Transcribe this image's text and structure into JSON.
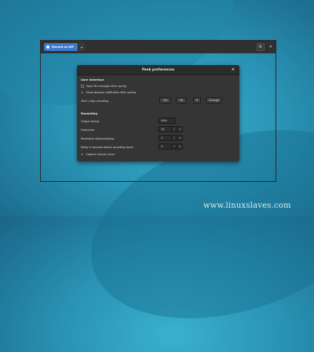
{
  "peek": {
    "record_label": "Record as GIF",
    "menu_icon": "chevron-down-icon",
    "settings_icon": "gear-icon",
    "close_icon": "close-icon"
  },
  "dialog": {
    "title": "Peek preferences",
    "close_glyph": "×",
    "user_interface": {
      "heading": "User interface",
      "open_file_manager": {
        "label": "Open file manager after saving",
        "checked": false
      },
      "show_notification": {
        "label": "Show desktop notification after saving",
        "checked": true
      },
      "shortcut": {
        "label": "Start / stop recording",
        "keys": [
          "Ctrl",
          "Alt",
          "R"
        ],
        "change_label": "Change"
      }
    },
    "recording": {
      "heading": "Recording",
      "output_format": {
        "label": "Output format",
        "value": "GIF"
      },
      "framerate": {
        "label": "Framerate",
        "value": "10"
      },
      "downsampling": {
        "label": "Resolution downsampling",
        "value": "1"
      },
      "delay": {
        "label": "Delay in seconds before recording starts",
        "value": "3"
      },
      "capture_cursor": {
        "label": "Capture mouse cursor",
        "checked": true
      }
    }
  },
  "watermark": "www.linuxslaves.com",
  "colors": {
    "accent": "#3c7bd0",
    "dialog_bg": "#353535"
  }
}
